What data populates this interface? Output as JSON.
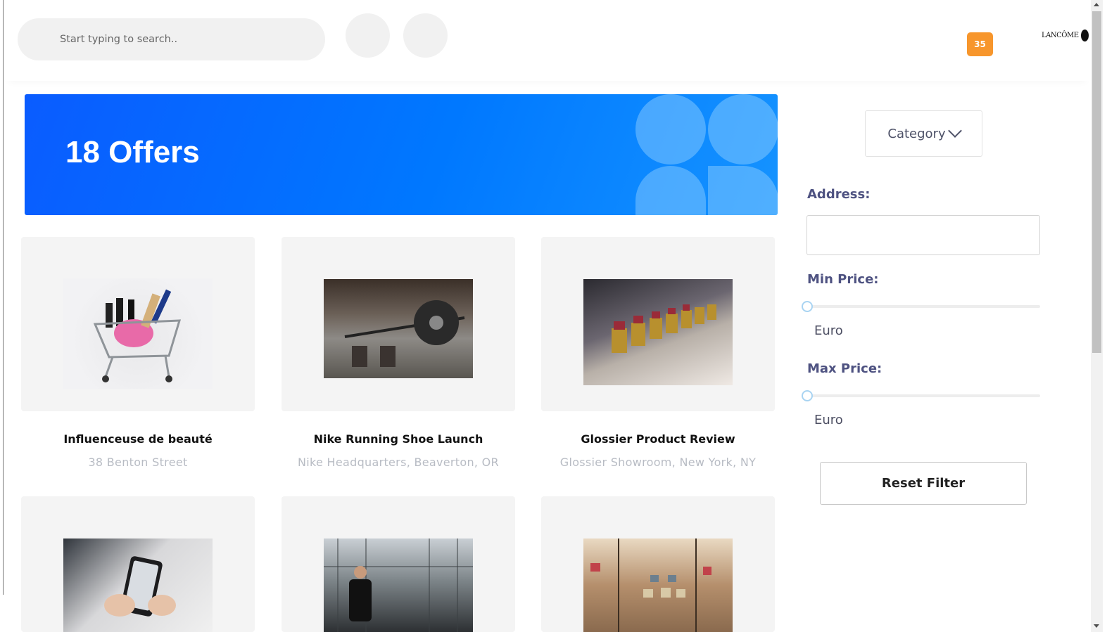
{
  "header": {
    "search_placeholder": "Start typing to search..",
    "notification_count": "35",
    "brand_name": "LANCÔME"
  },
  "hero": {
    "title": "18 Offers"
  },
  "offers": [
    {
      "title": "Influenceuse de beauté",
      "location": "38 Benton Street",
      "image": "shopping-cart-cosmetics"
    },
    {
      "title": "Nike Running Shoe Launch",
      "location": "Nike Headquarters, Beaverton, OR",
      "image": "weightlifting-barbell"
    },
    {
      "title": "Glossier Product Review",
      "location": "Glossier Showroom, New York, NY",
      "image": "lipsticks-row"
    },
    {
      "title": "",
      "location": "",
      "image": "hands-holding-phone"
    },
    {
      "title": "",
      "location": "",
      "image": "tennis-player"
    },
    {
      "title": "",
      "location": "",
      "image": "handbag-boutique"
    }
  ],
  "sidebar": {
    "category_label": "Category",
    "address_label": "Address:",
    "address_value": "",
    "min_price_label": "Min Price:",
    "min_price_value": 0,
    "min_price_unit": "Euro",
    "max_price_label": "Max Price:",
    "max_price_value": 0,
    "max_price_unit": "Euro",
    "reset_label": "Reset Filter"
  },
  "colors": {
    "hero_blue": "#0a6cff",
    "badge_orange": "#f7962c",
    "label_purple": "#4e5281"
  }
}
